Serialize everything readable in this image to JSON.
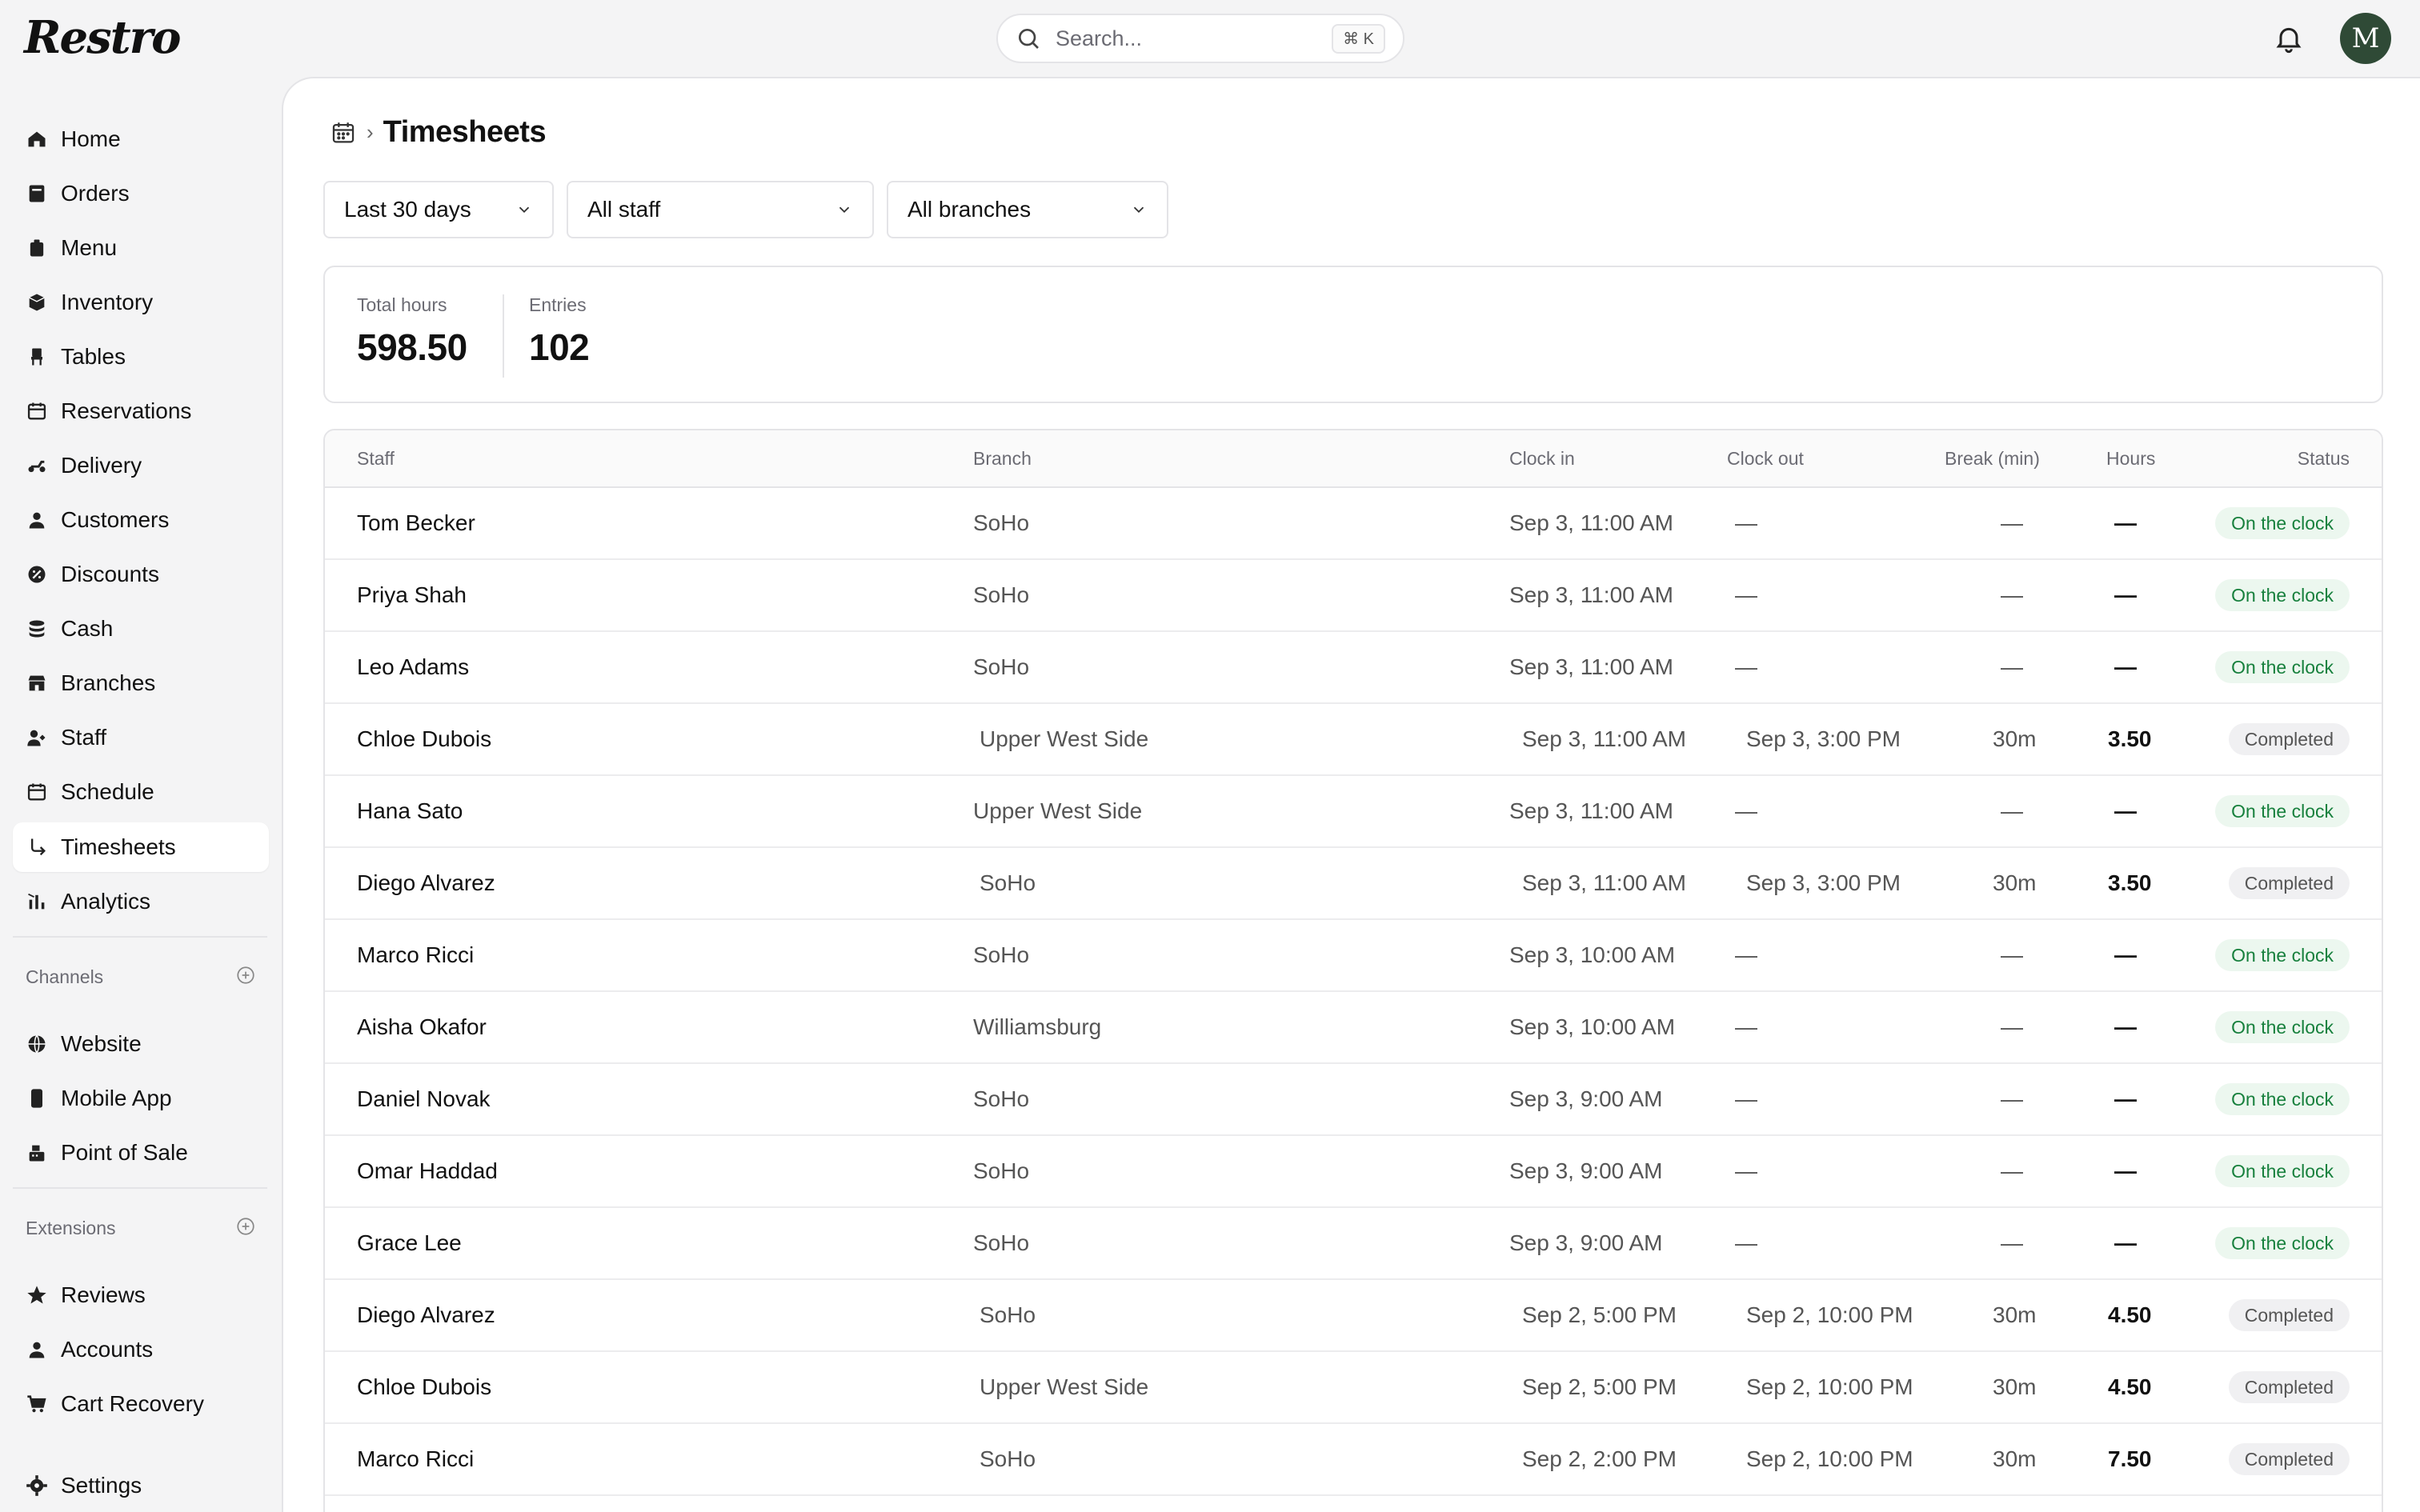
{
  "app": {
    "logo": "Restro"
  },
  "search": {
    "placeholder": "Search...",
    "shortcut": "⌘ K"
  },
  "user": {
    "initial": "M"
  },
  "sidebar": {
    "items": [
      {
        "label": "Home",
        "icon": "home-icon"
      },
      {
        "label": "Orders",
        "icon": "orders-icon"
      },
      {
        "label": "Menu",
        "icon": "menu-icon"
      },
      {
        "label": "Inventory",
        "icon": "inventory-icon"
      },
      {
        "label": "Tables",
        "icon": "chair-icon"
      },
      {
        "label": "Reservations",
        "icon": "calendar-icon"
      },
      {
        "label": "Delivery",
        "icon": "scooter-icon"
      },
      {
        "label": "Customers",
        "icon": "person-icon"
      },
      {
        "label": "Discounts",
        "icon": "discount-icon"
      },
      {
        "label": "Cash",
        "icon": "coins-icon"
      },
      {
        "label": "Branches",
        "icon": "store-icon"
      },
      {
        "label": "Staff",
        "icon": "staff-icon"
      },
      {
        "label": "Schedule",
        "icon": "calendar-icon"
      },
      {
        "label": "Timesheets",
        "icon": "sub-arrow-icon",
        "active": true
      },
      {
        "label": "Analytics",
        "icon": "bar-chart-icon"
      }
    ],
    "channels_label": "Channels",
    "channels": [
      {
        "label": "Website",
        "icon": "globe-icon"
      },
      {
        "label": "Mobile App",
        "icon": "phone-icon"
      },
      {
        "label": "Point of Sale",
        "icon": "register-icon"
      }
    ],
    "extensions_label": "Extensions",
    "extensions": [
      {
        "label": "Reviews",
        "icon": "star-icon"
      },
      {
        "label": "Accounts",
        "icon": "person-icon"
      },
      {
        "label": "Cart Recovery",
        "icon": "cart-icon"
      }
    ],
    "settings_label": "Settings"
  },
  "page": {
    "title": "Timesheets"
  },
  "filters": {
    "range": "Last 30 days",
    "staff": "All staff",
    "branches": "All branches"
  },
  "stats": {
    "total_hours_label": "Total hours",
    "total_hours": "598.50",
    "entries_label": "Entries",
    "entries": "102"
  },
  "table": {
    "headers": {
      "staff": "Staff",
      "branch": "Branch",
      "clock_in": "Clock in",
      "clock_out": "Clock out",
      "break": "Break (min)",
      "hours": "Hours",
      "status": "Status"
    },
    "rows": [
      {
        "staff": "Tom Becker",
        "branch": "SoHo",
        "clock_in": "Sep 3, 11:00 AM",
        "clock_out": "—",
        "break": "—",
        "hours": "—",
        "status": "On the clock"
      },
      {
        "staff": "Priya Shah",
        "branch": "SoHo",
        "clock_in": "Sep 3, 11:00 AM",
        "clock_out": "—",
        "break": "—",
        "hours": "—",
        "status": "On the clock"
      },
      {
        "staff": "Leo Adams",
        "branch": "SoHo",
        "clock_in": "Sep 3, 11:00 AM",
        "clock_out": "—",
        "break": "—",
        "hours": "—",
        "status": "On the clock"
      },
      {
        "staff": "Chloe Dubois",
        "branch": "Upper West Side",
        "clock_in": "Sep 3, 11:00 AM",
        "clock_out": "Sep 3, 3:00 PM",
        "break": "30m",
        "hours": "3.50",
        "status": "Completed"
      },
      {
        "staff": "Hana Sato",
        "branch": "Upper West Side",
        "clock_in": "Sep 3, 11:00 AM",
        "clock_out": "—",
        "break": "—",
        "hours": "—",
        "status": "On the clock"
      },
      {
        "staff": "Diego Alvarez",
        "branch": "SoHo",
        "clock_in": "Sep 3, 11:00 AM",
        "clock_out": "Sep 3, 3:00 PM",
        "break": "30m",
        "hours": "3.50",
        "status": "Completed"
      },
      {
        "staff": "Marco Ricci",
        "branch": "SoHo",
        "clock_in": "Sep 3, 10:00 AM",
        "clock_out": "—",
        "break": "—",
        "hours": "—",
        "status": "On the clock"
      },
      {
        "staff": "Aisha Okafor",
        "branch": "Williamsburg",
        "clock_in": "Sep 3, 10:00 AM",
        "clock_out": "—",
        "break": "—",
        "hours": "—",
        "status": "On the clock"
      },
      {
        "staff": "Daniel Novak",
        "branch": "SoHo",
        "clock_in": "Sep 3, 9:00 AM",
        "clock_out": "—",
        "break": "—",
        "hours": "—",
        "status": "On the clock"
      },
      {
        "staff": "Omar Haddad",
        "branch": "SoHo",
        "clock_in": "Sep 3, 9:00 AM",
        "clock_out": "—",
        "break": "—",
        "hours": "—",
        "status": "On the clock"
      },
      {
        "staff": "Grace Lee",
        "branch": "SoHo",
        "clock_in": "Sep 3, 9:00 AM",
        "clock_out": "—",
        "break": "—",
        "hours": "—",
        "status": "On the clock"
      },
      {
        "staff": "Diego Alvarez",
        "branch": "SoHo",
        "clock_in": "Sep 2, 5:00 PM",
        "clock_out": "Sep 2, 10:00 PM",
        "break": "30m",
        "hours": "4.50",
        "status": "Completed"
      },
      {
        "staff": "Chloe Dubois",
        "branch": "Upper West Side",
        "clock_in": "Sep 2, 5:00 PM",
        "clock_out": "Sep 2, 10:00 PM",
        "break": "30m",
        "hours": "4.50",
        "status": "Completed"
      },
      {
        "staff": "Marco Ricci",
        "branch": "SoHo",
        "clock_in": "Sep 2, 2:00 PM",
        "clock_out": "Sep 2, 10:00 PM",
        "break": "30m",
        "hours": "7.50",
        "status": "Completed"
      }
    ]
  },
  "colors": {
    "on_clock_bg": "#ecf7ef",
    "on_clock_fg": "#17803d",
    "completed_bg": "#f0f0f2",
    "avatar": "#2f4a36"
  }
}
